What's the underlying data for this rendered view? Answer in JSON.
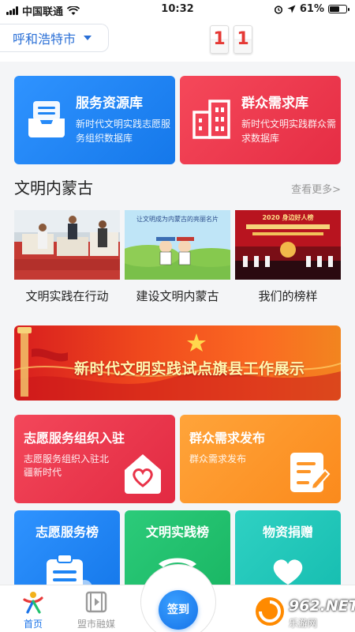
{
  "status_bar": {
    "carrier": "中国联通",
    "time": "10:32",
    "battery": "61%",
    "battery_level": 0.61
  },
  "header": {
    "city": "呼和浩特市",
    "counter": [
      "1",
      "1"
    ]
  },
  "big_cards": [
    {
      "title": "服务资源库",
      "subtitle": "新时代文明实践志愿服务组织数据库",
      "icon": "inbox-tray-icon",
      "color": "#1d84f4"
    },
    {
      "title": "群众需求库",
      "subtitle": "新时代文明实践群众需求数据库",
      "icon": "buildings-icon",
      "color": "#ec3a4e"
    }
  ],
  "section": {
    "title": "文明内蒙古",
    "more": "查看更多>"
  },
  "thumbs": [
    {
      "label": "文明实践在行动",
      "icon": "volunteers-photo"
    },
    {
      "label": "建设文明内蒙古",
      "icon": "cartoon-poster-photo",
      "caption": "让文明成为内蒙古的亮丽名片"
    },
    {
      "label": "我们的榜样",
      "icon": "stage-ceremony-photo",
      "caption": "2020 身边好人榜"
    }
  ],
  "banner": {
    "text": "新时代文明实践试点旗县工作展示"
  },
  "mid_cards": [
    {
      "title": "志愿服务组织入驻",
      "subtitle": "志愿服务组织入驻北疆新时代",
      "icon": "home-heart-icon",
      "color": "#e93349"
    },
    {
      "title": "群众需求发布",
      "subtitle": "群众需求发布",
      "icon": "edit-document-icon",
      "color": "#fd9527"
    }
  ],
  "small_cards": [
    {
      "title": "志愿服务榜",
      "icon": "clipboard-icon",
      "color": "#1d84f4"
    },
    {
      "title": "文明实践榜",
      "icon": "ribbon-badge-icon",
      "color": "#22c16e"
    },
    {
      "title": "物资捐赠",
      "icon": "heart-hands-icon",
      "color": "#22c7b9"
    }
  ],
  "tabbar": {
    "home": "首页",
    "media": "盟市融媒",
    "signin": "签到"
  },
  "watermark": {
    "text": "962.NET",
    "sub": "乐游网"
  }
}
